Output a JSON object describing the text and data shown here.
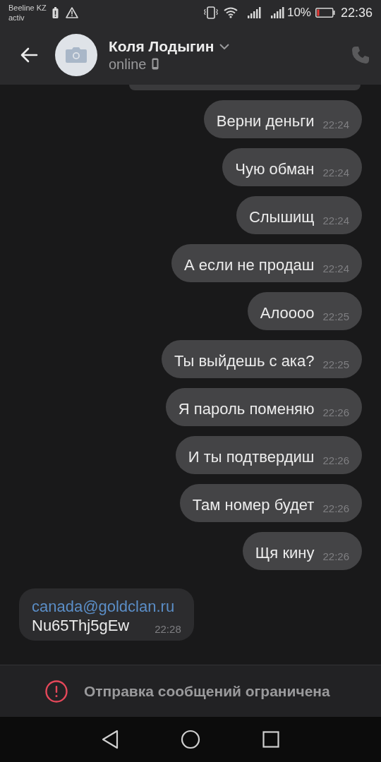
{
  "status_bar": {
    "carrier": [
      "Beeline KZ",
      "activ"
    ],
    "battery_percent": "10%",
    "time": "22:36"
  },
  "header": {
    "name": "Коля Лодыгин",
    "status": "online"
  },
  "messages": [
    {
      "kind": "outgoing",
      "lines": [
        {
          "kind": "text",
          "text": "Верни деньги"
        }
      ],
      "time": "22:24"
    },
    {
      "kind": "outgoing",
      "lines": [
        {
          "kind": "text",
          "text": "Чую обман"
        }
      ],
      "time": "22:24"
    },
    {
      "kind": "outgoing",
      "lines": [
        {
          "kind": "text",
          "text": "Слышищ"
        }
      ],
      "time": "22:24"
    },
    {
      "kind": "outgoing",
      "lines": [
        {
          "kind": "text",
          "text": "А если не продаш"
        }
      ],
      "time": "22:24"
    },
    {
      "kind": "outgoing",
      "lines": [
        {
          "kind": "text",
          "text": "Алоооо"
        }
      ],
      "time": "22:25"
    },
    {
      "kind": "outgoing",
      "lines": [
        {
          "kind": "text",
          "text": "Ты выйдешь с ака?"
        }
      ],
      "time": "22:25"
    },
    {
      "kind": "outgoing",
      "lines": [
        {
          "kind": "text",
          "text": "Я пароль поменяю"
        }
      ],
      "time": "22:26"
    },
    {
      "kind": "outgoing",
      "lines": [
        {
          "kind": "text",
          "text": "И ты подтвердиш"
        }
      ],
      "time": "22:26"
    },
    {
      "kind": "outgoing",
      "lines": [
        {
          "kind": "text",
          "text": "Там номер будет"
        }
      ],
      "time": "22:26"
    },
    {
      "kind": "outgoing",
      "lines": [
        {
          "kind": "text",
          "text": "Щя кину"
        }
      ],
      "time": "22:26"
    },
    {
      "kind": "incoming",
      "lines": [
        {
          "kind": "link",
          "text": "canada@goldclan.ru"
        },
        {
          "kind": "text",
          "text": "Nu65Thj5gEw"
        }
      ],
      "time": "22:28"
    }
  ],
  "restriction": {
    "text": "Отправка сообщений ограничена"
  }
}
